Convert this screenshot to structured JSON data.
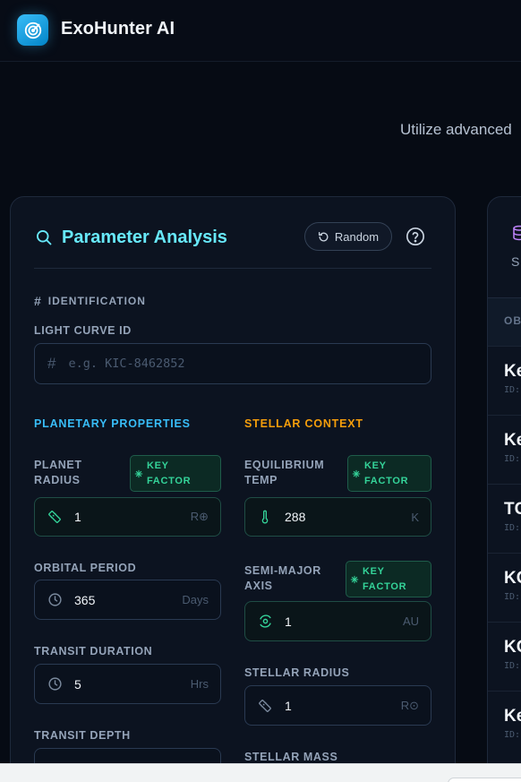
{
  "app": {
    "title": "ExoHunter AI",
    "tagline": "Utilize advanced"
  },
  "panel": {
    "title": "Parameter Analysis",
    "random_label": "Random",
    "identification": {
      "heading": "IDENTIFICATION",
      "light_curve_label": "LIGHT CURVE ID",
      "light_curve_placeholder": "e.g. KIC-8462852",
      "light_curve_value": ""
    },
    "planetary": {
      "heading": "PLANETARY PROPERTIES",
      "planet_radius": {
        "label_line1": "PLANET",
        "label_line2": "RADIUS",
        "value": "1",
        "unit": "R⊕",
        "badge_line1": "KEY",
        "badge_line2": "FACTOR"
      },
      "orbital_period": {
        "label": "ORBITAL PERIOD",
        "value": "365",
        "unit": "Days"
      },
      "transit_duration": {
        "label": "TRANSIT DURATION",
        "value": "5",
        "unit": "Hrs"
      },
      "transit_depth": {
        "label": "TRANSIT DEPTH"
      }
    },
    "stellar": {
      "heading": "STELLAR CONTEXT",
      "equilibrium_temp": {
        "label_line1": "EQUILIBRIUM",
        "label_line2": "TEMP",
        "value": "288",
        "unit": "K",
        "badge_line1": "KEY",
        "badge_line2": "FACTOR"
      },
      "semi_major_axis": {
        "label_line1": "SEMI-MAJOR",
        "label_line2": "AXIS",
        "value": "1",
        "unit": "AU",
        "badge_line1": "KEY",
        "badge_line2": "FACTOR"
      },
      "stellar_radius": {
        "label": "STELLAR RADIUS",
        "value": "1",
        "unit": "R⊙"
      },
      "stellar_mass": {
        "label": "STELLAR MASS"
      }
    }
  },
  "side_panel": {
    "header_letter": "S",
    "column_header": "OB",
    "rows": [
      {
        "name": "Ke",
        "id": "ID:"
      },
      {
        "name": "Ke",
        "id": "ID:"
      },
      {
        "name": "TC",
        "id": "ID:"
      },
      {
        "name": "KC",
        "id": "ID:"
      },
      {
        "name": "KC",
        "id": "ID:"
      },
      {
        "name": "Ke",
        "id": "ID:"
      }
    ]
  },
  "colors": {
    "accent_cyan": "#67e8f9",
    "planetary_heading": "#38bdf8",
    "stellar_heading": "#f59e0b",
    "key_factor": "#34d399"
  }
}
